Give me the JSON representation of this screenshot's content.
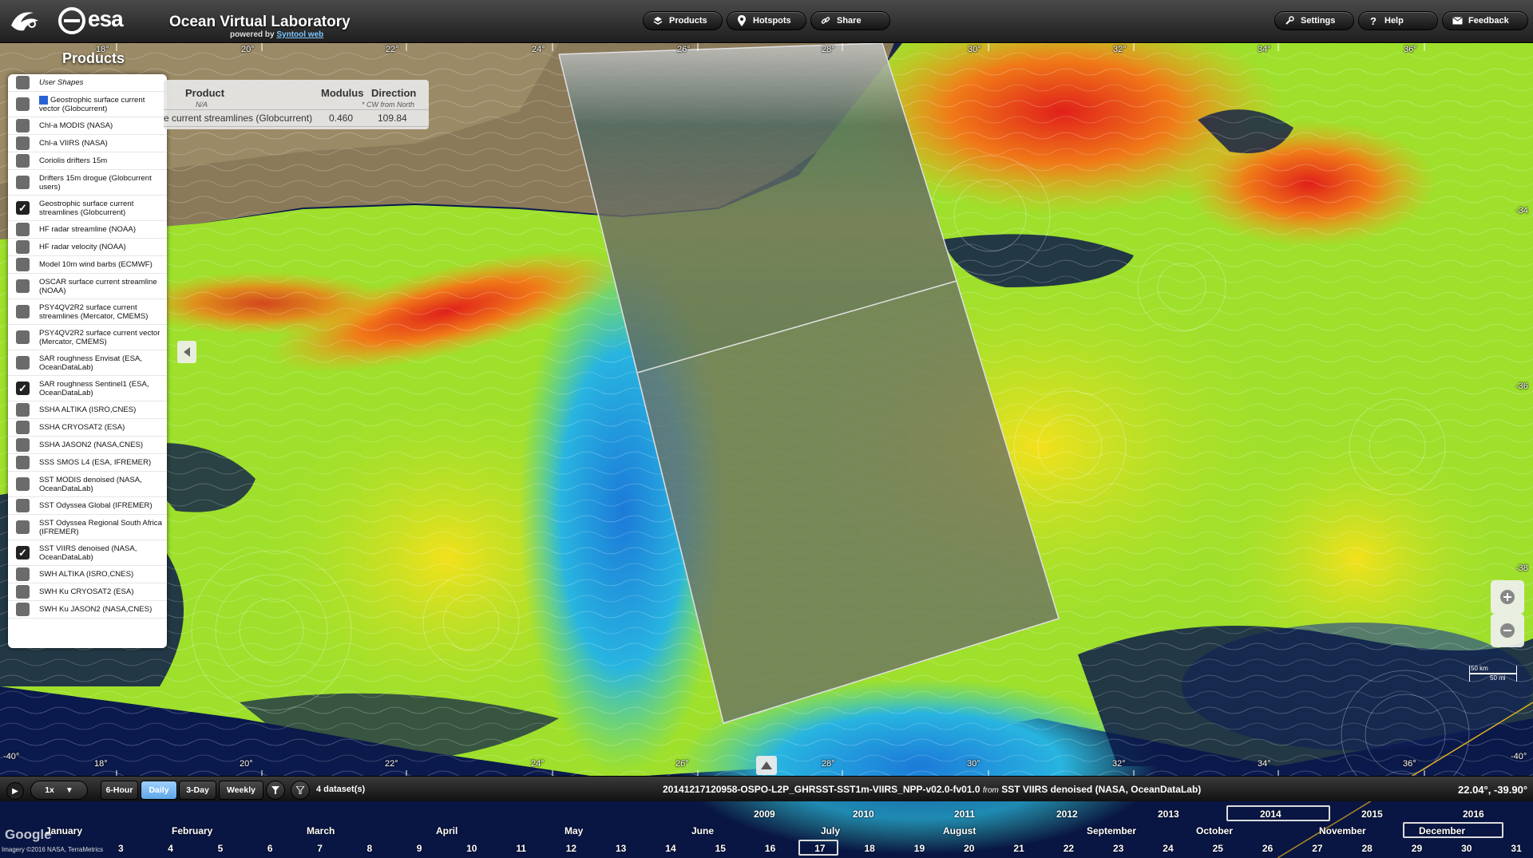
{
  "header": {
    "title": "Ocean Virtual Laboratory",
    "powered_prefix": "powered by",
    "powered_link": "Syntool web",
    "esa_label": "esa",
    "buttons": [
      {
        "id": "products",
        "label": "Products",
        "icon": "layers-icon"
      },
      {
        "id": "hotspots",
        "label": "Hotspots",
        "icon": "pin-icon"
      },
      {
        "id": "share",
        "label": "Share",
        "icon": "link-icon"
      },
      {
        "id": "settings",
        "label": "Settings",
        "icon": "wrench-icon"
      },
      {
        "id": "help",
        "label": "Help",
        "icon": "question-icon"
      },
      {
        "id": "feedback",
        "label": "Feedback",
        "icon": "envelope-icon"
      }
    ]
  },
  "axis": {
    "top_ticks": [
      "18°",
      "20°",
      "22°",
      "24°",
      "26°",
      "28°",
      "30°",
      "32°",
      "34°",
      "36°"
    ],
    "bottom_ticks": [
      "18°",
      "20°",
      "22°",
      "24°",
      "26°",
      "28°",
      "30°",
      "32°",
      "34°",
      "36°"
    ],
    "left_lat": "-40°",
    "right_lats": [
      "-34",
      "-36",
      "-38",
      "-40°"
    ]
  },
  "products": {
    "title": "Products",
    "items": [
      {
        "label": "User Shapes",
        "checked": false,
        "italic": true
      },
      {
        "label": "Geostrophic surface current vector (Globcurrent)",
        "checked": false,
        "swatch": true
      },
      {
        "label": "Chl-a MODIS (NASA)",
        "checked": false
      },
      {
        "label": "Chl-a VIIRS (NASA)",
        "checked": false
      },
      {
        "label": "Coriolis drifters 15m",
        "checked": false
      },
      {
        "label": "Drifters 15m drogue (Globcurrent users)",
        "checked": false
      },
      {
        "label": "Geostrophic surface current streamlines (Globcurrent)",
        "checked": true
      },
      {
        "label": "HF radar streamline (NOAA)",
        "checked": false
      },
      {
        "label": "HF radar velocity (NOAA)",
        "checked": false
      },
      {
        "label": "Model 10m wind barbs (ECMWF)",
        "checked": false
      },
      {
        "label": "OSCAR surface current streamline (NOAA)",
        "checked": false
      },
      {
        "label": "PSY4QV2R2 surface current streamlines (Mercator, CMEMS)",
        "checked": false
      },
      {
        "label": "PSY4QV2R2 surface current vector (Mercator, CMEMS)",
        "checked": false
      },
      {
        "label": "SAR roughness Envisat (ESA, OceanDataLab)",
        "checked": false
      },
      {
        "label": "SAR roughness Sentinel1 (ESA, OceanDataLab)",
        "checked": true
      },
      {
        "label": "SSHA ALTIKA (ISRO,CNES)",
        "checked": false
      },
      {
        "label": "SSHA CRYOSAT2 (ESA)",
        "checked": false
      },
      {
        "label": "SSHA JASON2 (NASA,CNES)",
        "checked": false
      },
      {
        "label": "SSS SMOS L4 (ESA, IFREMER)",
        "checked": false
      },
      {
        "label": "SST MODIS denoised (NASA, OceanDataLab)",
        "checked": false
      },
      {
        "label": "SST Odyssea Global (IFREMER)",
        "checked": false
      },
      {
        "label": "SST Odyssea Regional South Africa (IFREMER)",
        "checked": false
      },
      {
        "label": "SST VIIRS denoised (NASA, OceanDataLab)",
        "checked": true
      },
      {
        "label": "SWH ALTIKA (ISRO,CNES)",
        "checked": false
      },
      {
        "label": "SWH Ku CRYOSAT2 (ESA)",
        "checked": false
      },
      {
        "label": "SWH Ku JASON2 (NASA,CNES)",
        "checked": false
      }
    ]
  },
  "info": {
    "col_product": "Product",
    "col_product_sub": "N/A",
    "col_modulus": "Modulus",
    "col_direction": "Direction",
    "col_direction_sub": "* CW from North",
    "row_product": "e current streamlines (Globcurrent)",
    "row_modulus": "0.460",
    "row_direction": "109.84"
  },
  "scale": {
    "km": "50 km",
    "mi": "50 mi"
  },
  "timebar": {
    "speed": "1x",
    "steps": [
      {
        "label": "6-Hour",
        "active": false
      },
      {
        "label": "Daily",
        "active": true
      },
      {
        "label": "3-Day",
        "active": false
      },
      {
        "label": "Weekly",
        "active": false
      }
    ],
    "datasets": "4 dataset(s)",
    "granule": "20141217120958-OSPO-L2P_GHRSST-SST1m-VIIRS_NPP-v02.0-fv01.0",
    "granule_from": "from",
    "granule_source": "SST VIIRS denoised (NASA, OceanDataLab)",
    "coords": "22.04°, -39.90°"
  },
  "timeline": {
    "years": [
      "2009",
      "2010",
      "2011",
      "2012",
      "2013",
      "2014",
      "2015",
      "2016"
    ],
    "selected_year": "2014",
    "months": [
      "January",
      "February",
      "March",
      "April",
      "May",
      "June",
      "July",
      "August",
      "September",
      "October",
      "November",
      "December"
    ],
    "selected_month": "December",
    "days": [
      "3",
      "4",
      "5",
      "6",
      "7",
      "8",
      "9",
      "10",
      "11",
      "12",
      "13",
      "14",
      "15",
      "16",
      "17",
      "18",
      "19",
      "20",
      "21",
      "22",
      "23",
      "24",
      "25",
      "26",
      "27",
      "28",
      "29",
      "30",
      "31"
    ],
    "selected_day": "17"
  },
  "attribution": "Imagery ©2016 NASA, TerraMetrics",
  "google": "Google",
  "colors": {
    "ocean_dark": "#0b1a4d",
    "sst_warm": "#e8401a",
    "sst_cool": "#27b4e0",
    "sst_mid": "#9ee02c",
    "land": "#8a7a5a",
    "accent_active": "#6fb4f0"
  }
}
